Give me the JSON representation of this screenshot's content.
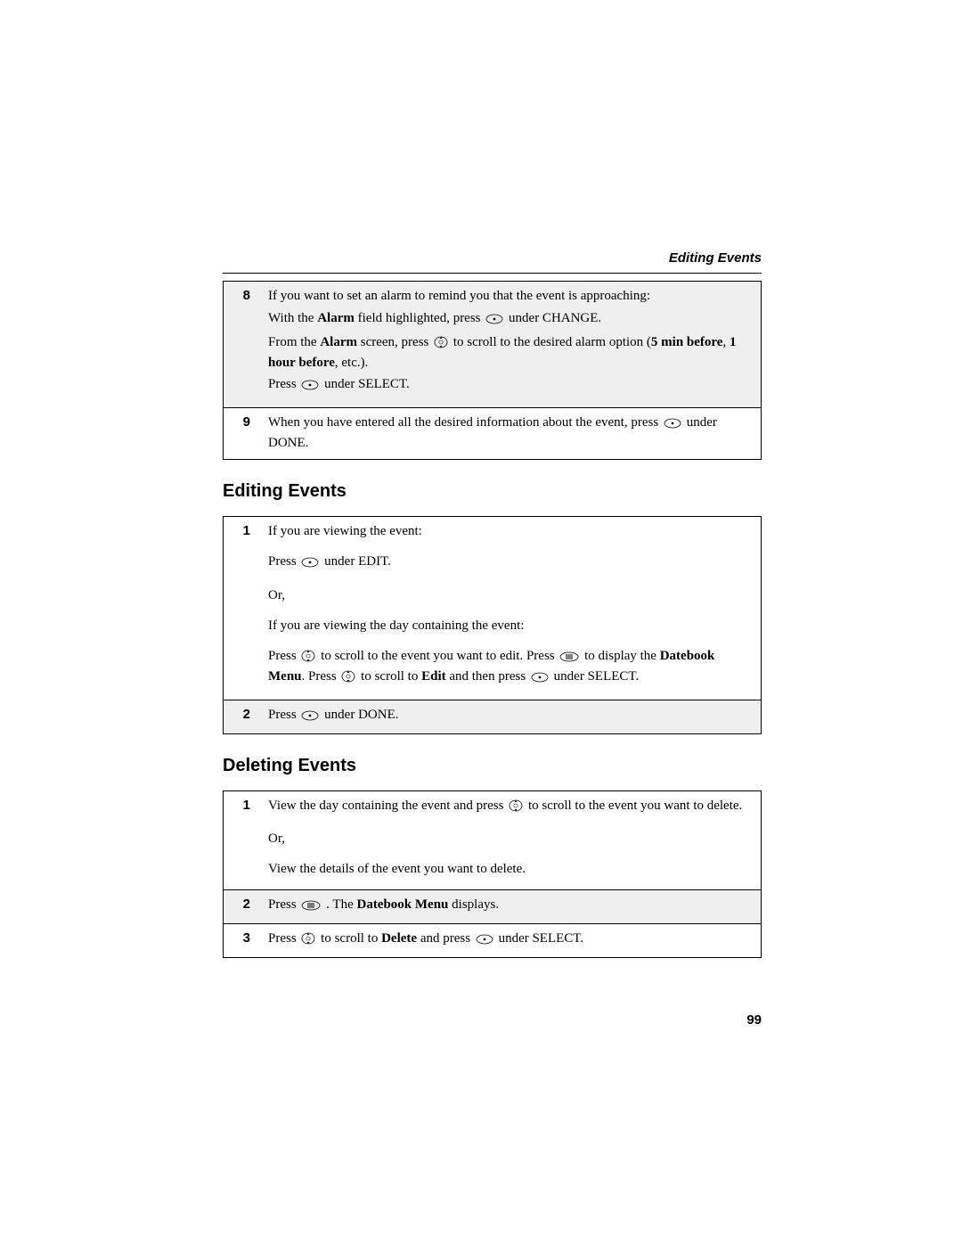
{
  "running_head": "Editing Events",
  "page_number": "99",
  "top_steps": {
    "8": {
      "l1": "If you want to set an alarm to remind you that the event is approaching:",
      "l2a": "With the ",
      "l2b": "Alarm",
      "l2c": " field highlighted, press ",
      "l2d": " under CHANGE.",
      "l3a": "From the ",
      "l3b": "Alarm",
      "l3c": " screen, press ",
      "l3d": " to scroll to the desired alarm option (",
      "l3e": "5 min before",
      "l3f": ", ",
      "l3g": "1 hour before",
      "l3h": ", etc.).",
      "l4a": "Press ",
      "l4b": " under SELECT."
    },
    "9": {
      "a": "When you have entered all the desired information about the event, press ",
      "b": " under DONE."
    }
  },
  "sec_edit": "Editing Events",
  "edit_steps": {
    "1": {
      "a": "If you are viewing the event:",
      "b1": "Press ",
      "b2": " under EDIT.",
      "c": "Or,",
      "d": "If you are viewing the day containing the event:",
      "e1": "Press ",
      "e2": " to scroll to the event you want to edit. Press ",
      "e3": " to display the ",
      "e4": "Datebook Menu",
      "e5": ". Press ",
      "e6": " to scroll to ",
      "e7": "Edit",
      "e8": " and then press ",
      "e9": " under SELECT."
    },
    "2": {
      "a": "Press ",
      "b": " under DONE."
    }
  },
  "sec_del": "Deleting Events",
  "del_steps": {
    "1": {
      "a1": "View the day containing the event and press ",
      "a2": " to scroll to the event you want to delete.",
      "b": "Or,",
      "c": "View the details of the event you want to delete."
    },
    "2": {
      "a": "Press ",
      "b": ". The ",
      "c": "Datebook Menu",
      "d": " displays."
    },
    "3": {
      "a": "Press ",
      "b": " to scroll to ",
      "c": "Delete",
      "d": " and press ",
      "e": " under SELECT."
    }
  }
}
